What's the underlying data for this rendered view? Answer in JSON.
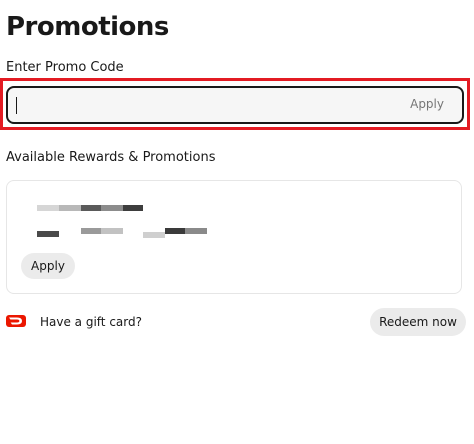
{
  "page": {
    "title": "Promotions"
  },
  "promo_code": {
    "label": "Enter Promo Code",
    "value": "",
    "apply_label": "Apply"
  },
  "rewards": {
    "section_title": "Available Rewards & Promotions",
    "card": {
      "apply_label": "Apply"
    }
  },
  "gift_card": {
    "text": "Have a gift card?",
    "redeem_label": "Redeem now",
    "icon": "doordash-logo-icon"
  },
  "colors": {
    "highlight": "#e31b23",
    "brand": "#eb1700"
  }
}
